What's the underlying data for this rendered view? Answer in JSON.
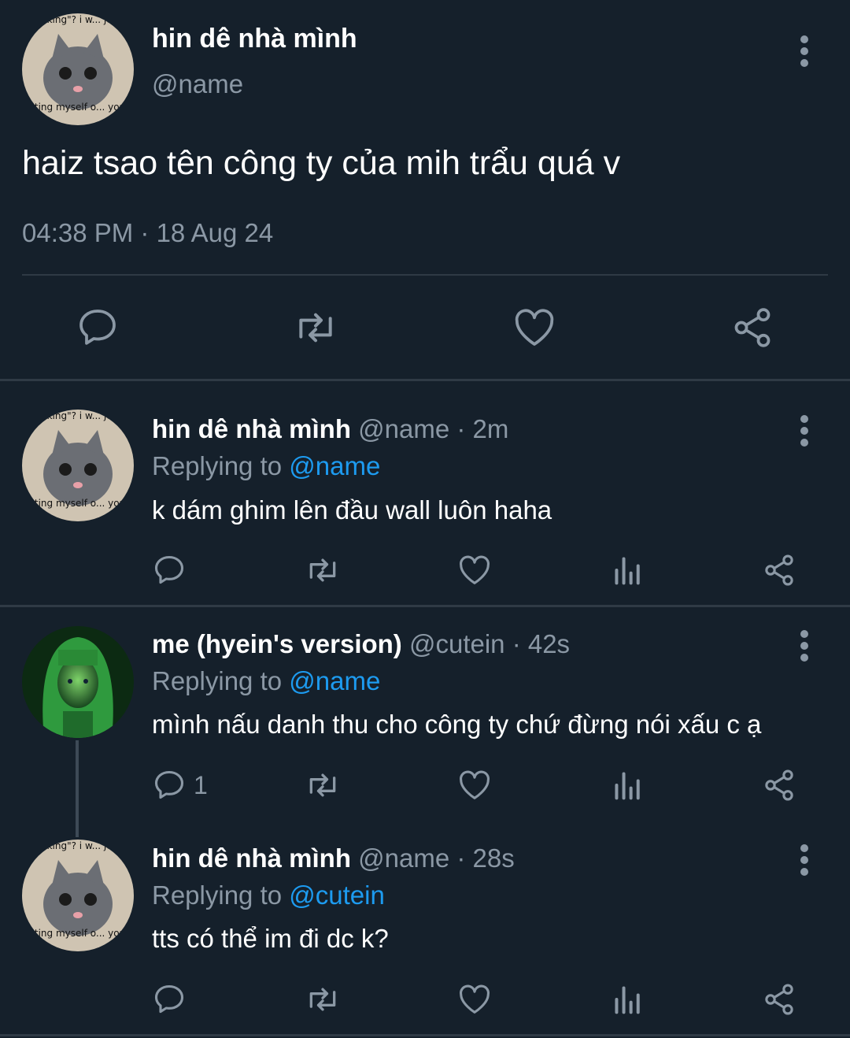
{
  "main_tweet": {
    "author_name": "hin dê nhà mình",
    "handle": "@name",
    "text": "haiz tsao tên công ty của mih trẩu quá v",
    "timestamp": "04:38 PM · 18 Aug 24",
    "avatar_caption_top": "talking\"? i w... just",
    "avatar_caption_bottom": "educating myself o... your lore"
  },
  "replies": [
    {
      "author_name": "hin dê nhà mình",
      "handle_time": "@name · 2m",
      "replying_prefix": "Replying to",
      "replying_to": "@name",
      "text": "k dám ghim lên đầu wall luôn haha",
      "reply_count": ""
    },
    {
      "author_name": "me (hyein's version)",
      "handle_time": "@cutein · 42s",
      "replying_prefix": "Replying to",
      "replying_to": "@name",
      "text": "mình nấu danh thu cho công ty chứ đừng nói xấu c ạ",
      "reply_count": "1"
    },
    {
      "author_name": "hin dê nhà mình",
      "handle_time": "@name · 28s",
      "replying_prefix": "Replying to",
      "replying_to": "@cutein",
      "text": "tts có thể im đi dc k?",
      "reply_count": ""
    }
  ],
  "icons": {
    "reply": "speech-bubble-icon",
    "retweet": "retweet-icon",
    "like": "heart-icon",
    "views": "bar-chart-icon",
    "share": "share-icon",
    "more": "vertical-dots-icon"
  },
  "colors": {
    "background": "#15202b",
    "text": "#e7e9ea",
    "muted": "#8b98a5",
    "link": "#1d9bf0"
  }
}
